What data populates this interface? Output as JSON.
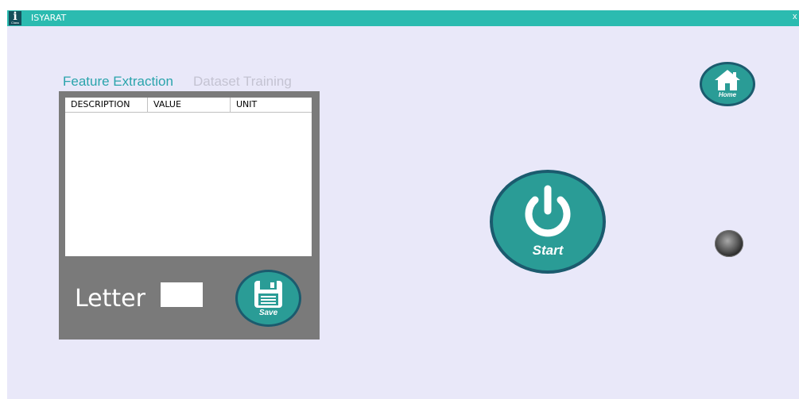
{
  "window": {
    "title": "ISYARAT",
    "icon_letter": "i",
    "icon_subtext": "Class",
    "close_label": "x",
    "icon": "app-i-icon"
  },
  "tabs": [
    {
      "label": "Feature Extraction",
      "active": true
    },
    {
      "label": "Dataset Training",
      "active": false
    }
  ],
  "table": {
    "columns": [
      "DESCRIPTION",
      "VALUE",
      "UNIT"
    ],
    "rows": []
  },
  "letter": {
    "label": "Letter",
    "value": ""
  },
  "buttons": {
    "save": {
      "label": "Save",
      "icon": "floppy-disk-icon"
    },
    "home": {
      "label": "Home",
      "icon": "house-icon"
    },
    "start": {
      "label": "Start",
      "icon": "power-icon"
    }
  },
  "indicator": {
    "state": "off",
    "icon": "status-led"
  },
  "colors": {
    "titlebar": "#2bbbb0",
    "background": "#e9e8f9",
    "panel": "#7a7a7a",
    "button_fill": "#2a9c96",
    "button_border": "#1b5b6e",
    "tab_active": "#2aa4ac",
    "tab_inactive": "#c4c3d2"
  }
}
